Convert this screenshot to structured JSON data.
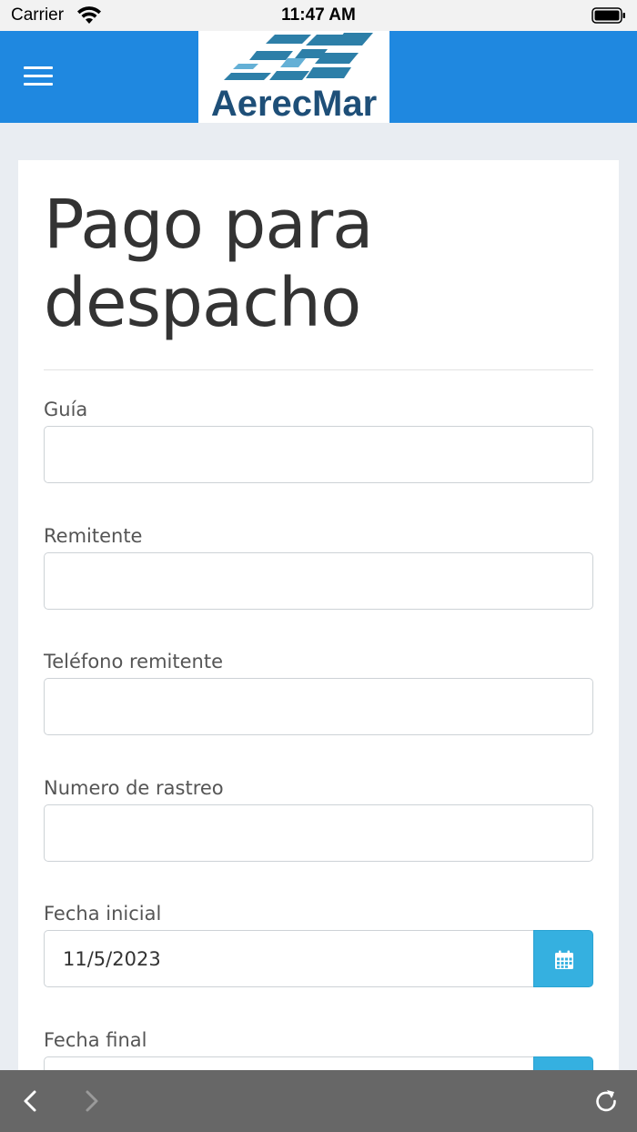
{
  "status_bar": {
    "carrier": "Carrier",
    "time": "11:47 AM"
  },
  "header": {
    "logo_text": "AerecMar",
    "brand_color": "#1f88e0"
  },
  "page": {
    "title": "Pago para despacho"
  },
  "form": {
    "fields": [
      {
        "label": "Guía",
        "value": ""
      },
      {
        "label": "Remitente",
        "value": ""
      },
      {
        "label": "Teléfono remitente",
        "value": ""
      },
      {
        "label": "Numero de rastreo",
        "value": ""
      },
      {
        "label": "Fecha inicial",
        "value": "11/5/2023"
      },
      {
        "label": "Fecha final",
        "value": ""
      }
    ]
  },
  "icons": {
    "menu": "hamburger-menu-icon",
    "calendar": "calendar-icon",
    "back": "chevron-left-icon",
    "forward": "chevron-right-icon",
    "reload": "reload-icon"
  },
  "colors": {
    "accent": "#35b0e0",
    "toolbar": "#676767",
    "title": "#333333"
  }
}
